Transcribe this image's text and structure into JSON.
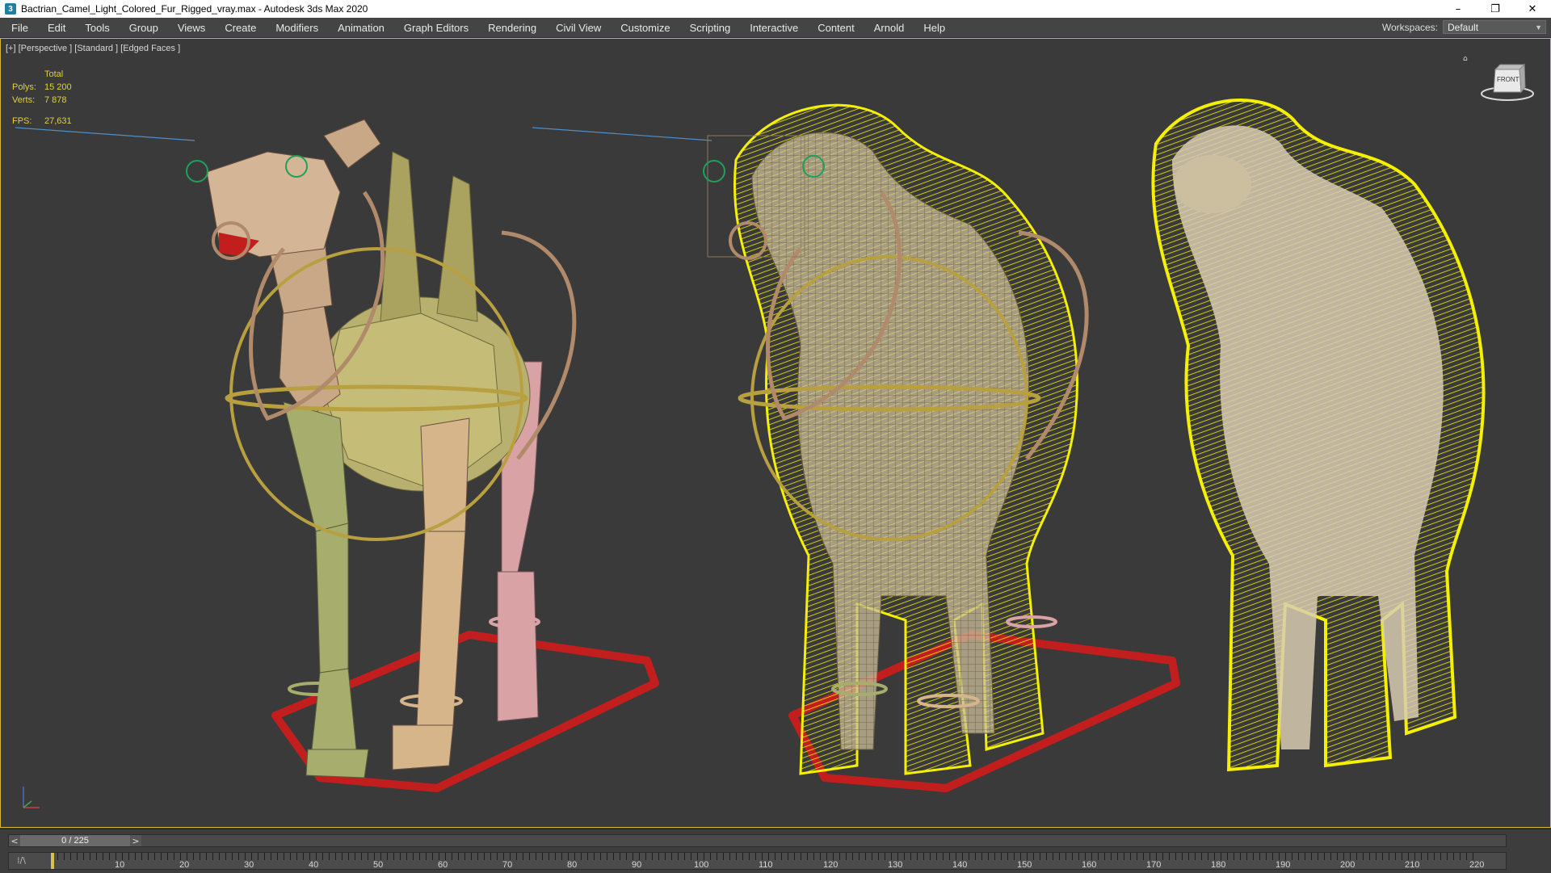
{
  "window": {
    "title": "Bactrian_Camel_Light_Colored_Fur_Rigged_vray.max - Autodesk 3ds Max 2020",
    "icon_glyph": "3",
    "controls": {
      "minimize": "–",
      "restore": "❐",
      "close": "✕"
    }
  },
  "menu": [
    "File",
    "Edit",
    "Tools",
    "Group",
    "Views",
    "Create",
    "Modifiers",
    "Animation",
    "Graph Editors",
    "Rendering",
    "Civil View",
    "Customize",
    "Scripting",
    "Interactive",
    "Content",
    "Arnold",
    "Help"
  ],
  "workspaces": {
    "label": "Workspaces:",
    "value": "Default"
  },
  "viewport": {
    "label": "[+] [Perspective ] [Standard ] [Edged Faces ]",
    "stats": {
      "header": "Total",
      "polys_label": "Polys:",
      "polys": "15 200",
      "verts_label": "Verts:",
      "verts": "7 878",
      "fps_label": "FPS:",
      "fps": "27,631"
    },
    "viewcube_label": "FRONT",
    "colors": {
      "fur": "#f4f000",
      "rig_ground": "#c21e1e",
      "rig_ring": "#b8a040",
      "border": "#d6b43c"
    }
  },
  "timeline": {
    "frame_display": "0 / 225",
    "prev": "<",
    "next": ">",
    "ruler_labels": [
      "10",
      "20",
      "30",
      "40",
      "50",
      "60",
      "70",
      "80",
      "90",
      "100",
      "110",
      "120",
      "130",
      "140",
      "150",
      "160",
      "170",
      "180",
      "190",
      "200",
      "210",
      "220"
    ]
  }
}
